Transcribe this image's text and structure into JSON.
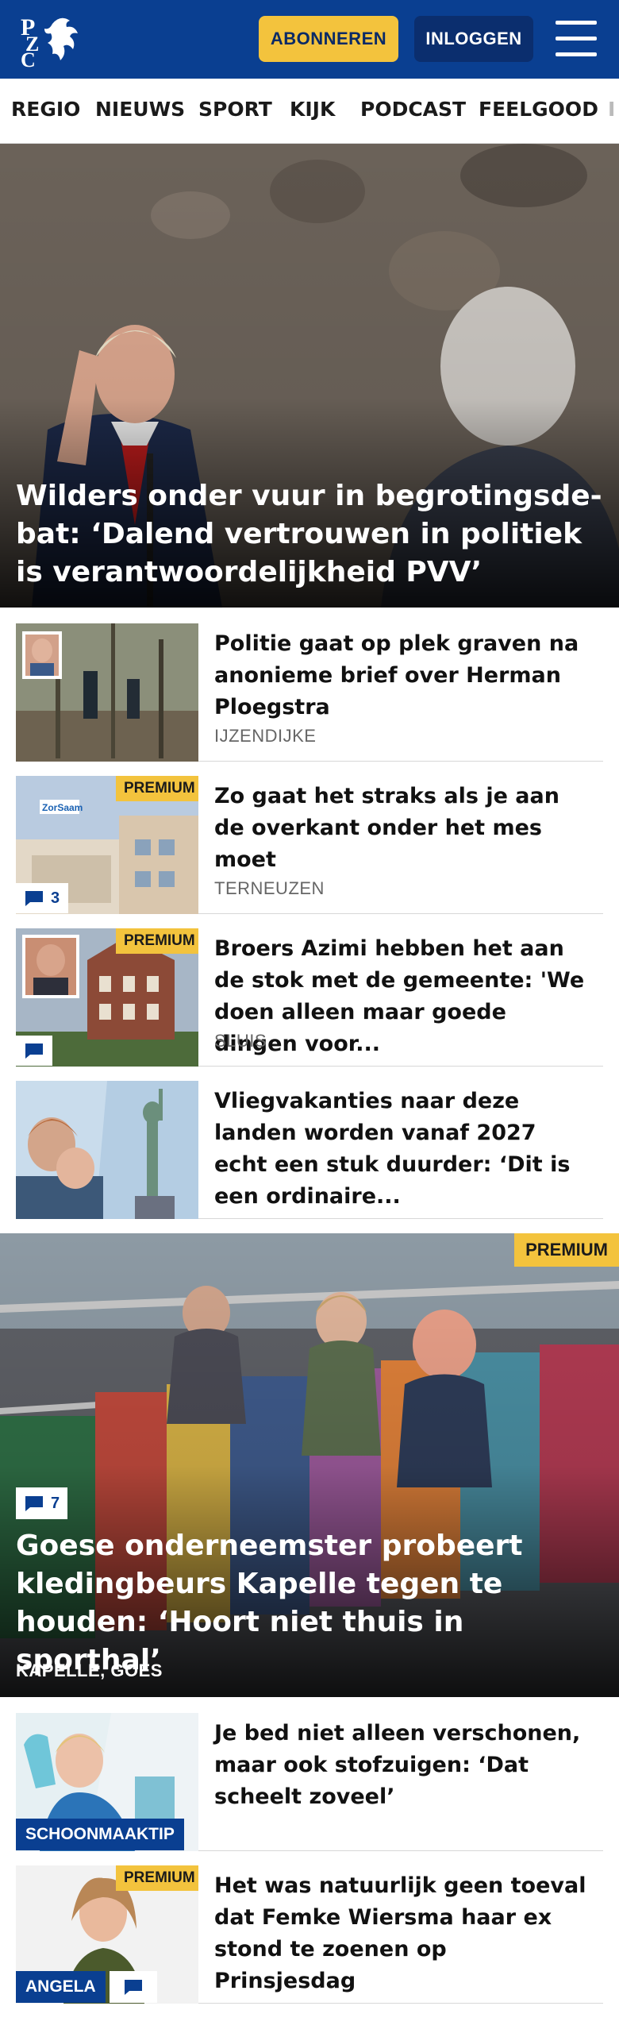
{
  "header": {
    "logo_text": "PZC",
    "subscribe_label": "ABONNEREN",
    "login_label": "INLOGGEN"
  },
  "nav": {
    "items": [
      "REGIO",
      "NIEUWS",
      "SPORT",
      "KIJK",
      "PODCAST",
      "FEELGOOD",
      "I"
    ]
  },
  "hero": {
    "title": "Wilders onder vuur in begrotingsde-bat: ‘Dalend vertrouwen in politiek is verantwoordelijkheid PVV’"
  },
  "articles": [
    {
      "title": "Politie gaat op plek graven na anonieme brief over Herman Ploegstra",
      "place": "IJZENDIJKE",
      "premium": "",
      "comments": ""
    },
    {
      "title": "Zo gaat het straks als je aan de overkant onder het mes moet",
      "place": "TERNEUZEN",
      "premium": "PREMIUM",
      "comments": "3"
    },
    {
      "title": "Broers Azimi hebben het aan de stok met de gemeente: 'We doen alleen maar goede dingen voor...",
      "place": "SLUIS",
      "premium": "PREMIUM",
      "comments": ""
    },
    {
      "title": "Vliegvakanties naar deze landen worden vanaf 2027 echt een stuk duurder: ‘Dit is een ordinaire...",
      "place": "",
      "premium": "",
      "comments": ""
    }
  ],
  "feature": {
    "premium": "PREMIUM",
    "comments": "7",
    "title": "Goese onderneemster probeert kledingbeurs Kapelle tegen te houden: ‘Hoort niet thuis in sporthal’",
    "place": "KAPELLE, GOES"
  },
  "articles2": [
    {
      "title": "Je bed niet alleen verschonen, maar ook stofzuigen: ‘Dat scheelt zoveel’",
      "label": "SCHOONMAAKTIP",
      "premium": ""
    },
    {
      "title": "Het was natuurlijk geen toeval dat Femke Wiersma haar ex stond te zoenen op Prinsjesdag",
      "label": "ANGELA",
      "premium": "PREMIUM"
    }
  ],
  "colors": {
    "brand_blue": "#0a3f91",
    "accent_yellow": "#f3c33d"
  },
  "icons": [
    "menu-icon",
    "comment-icon"
  ]
}
